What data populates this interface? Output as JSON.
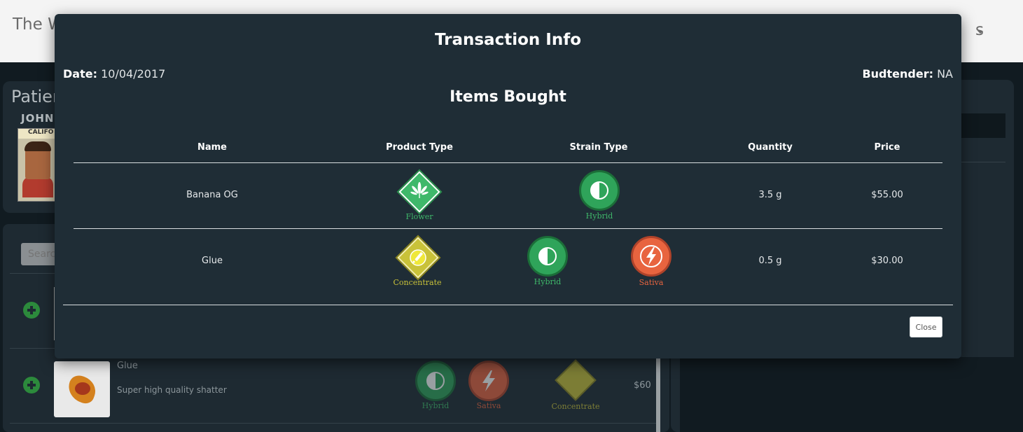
{
  "app": {
    "brand": "The W",
    "nav_right": "s"
  },
  "patient": {
    "title": "Patien",
    "name": "JOHN",
    "id_card_text": "CALIFO"
  },
  "search": {
    "placeholder": "Searc"
  },
  "product": {
    "name": "Glue",
    "description": "Super high quality shatter",
    "price": "$60",
    "strain_labels": [
      "Hybrid",
      "Sativa"
    ],
    "type_label": "Concentrate"
  },
  "modal": {
    "title": "Transaction Info",
    "date_label": "Date:",
    "date_value": "10/04/2017",
    "budtender_label": "Budtender:",
    "budtender_value": "NA",
    "subtitle": "Items Bought",
    "columns": [
      "Name",
      "Product Type",
      "Strain Type",
      "Quantity",
      "Price"
    ],
    "rows": [
      {
        "name": "Banana OG",
        "product_type": "Flower",
        "strains": [
          "Hybrid"
        ],
        "quantity": "3.5 g",
        "price": "$55.00"
      },
      {
        "name": "Glue",
        "product_type": "Concentrate",
        "strains": [
          "Hybrid",
          "Sativa"
        ],
        "quantity": "0.5 g",
        "price": "$30.00"
      }
    ],
    "close_label": "Close"
  },
  "colors": {
    "flower": "#3fb86a",
    "hybrid": "#2fa45a",
    "sativa": "#e8643f",
    "concentrate": "#c9c239"
  },
  "icons": {
    "flower": "cannabis-leaf-icon",
    "hybrid": "half-circle-icon",
    "sativa": "lightning-bolt-icon",
    "concentrate": "dropper-icon"
  }
}
